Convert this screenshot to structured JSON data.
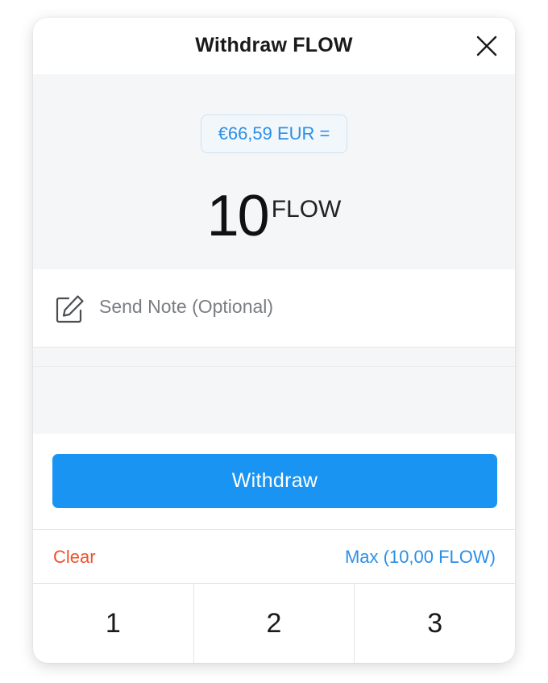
{
  "header": {
    "title": "Withdraw FLOW",
    "close_icon": "close-icon"
  },
  "amount": {
    "fiat_label": "€66,59 EUR =",
    "value": "10",
    "unit": "FLOW"
  },
  "note": {
    "icon": "edit-note-icon",
    "placeholder": "Send Note (Optional)",
    "value": ""
  },
  "actions": {
    "withdraw_label": "Withdraw",
    "clear_label": "Clear",
    "max_label": "Max (10,00 FLOW)"
  },
  "keypad": {
    "keys": [
      "1",
      "2",
      "3"
    ]
  },
  "colors": {
    "accent": "#1a94f2",
    "link_blue": "#2c8fe6",
    "danger": "#f0502a",
    "panel_bg": "#f5f6f7"
  }
}
